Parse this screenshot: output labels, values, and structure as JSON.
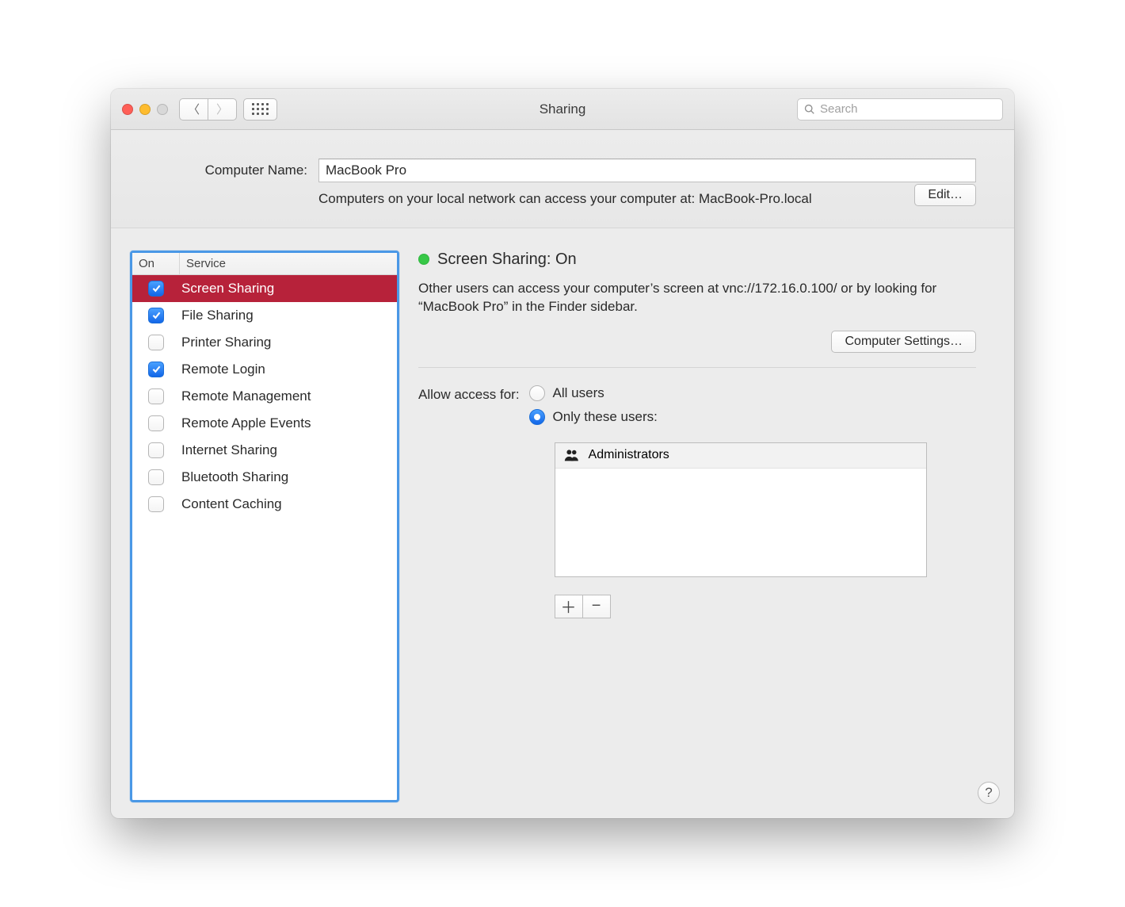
{
  "title": "Sharing",
  "search_placeholder": "Search",
  "computer_name_label": "Computer Name:",
  "computer_name_value": "MacBook Pro",
  "local_access_text": "Computers on your local network can access your computer at: MacBook-Pro.local",
  "edit_button": "Edit…",
  "services_header": {
    "on": "On",
    "service": "Service"
  },
  "services": [
    {
      "name": "Screen Sharing",
      "on": true,
      "selected": true
    },
    {
      "name": "File Sharing",
      "on": true,
      "selected": false
    },
    {
      "name": "Printer Sharing",
      "on": false,
      "selected": false
    },
    {
      "name": "Remote Login",
      "on": true,
      "selected": false
    },
    {
      "name": "Remote Management",
      "on": false,
      "selected": false
    },
    {
      "name": "Remote Apple Events",
      "on": false,
      "selected": false
    },
    {
      "name": "Internet Sharing",
      "on": false,
      "selected": false
    },
    {
      "name": "Bluetooth Sharing",
      "on": false,
      "selected": false
    },
    {
      "name": "Content Caching",
      "on": false,
      "selected": false
    }
  ],
  "status_title": "Screen Sharing: On",
  "status_desc": "Other users can access your computer’s screen at vnc://172.16.0.100/ or by looking for “MacBook Pro” in the Finder sidebar.",
  "computer_settings_button": "Computer Settings…",
  "allow_access_label": "Allow access for:",
  "radio_all_users": "All users",
  "radio_only_these": "Only these users:",
  "radio_selected": "only",
  "users": [
    "Administrators"
  ],
  "help_char": "?"
}
